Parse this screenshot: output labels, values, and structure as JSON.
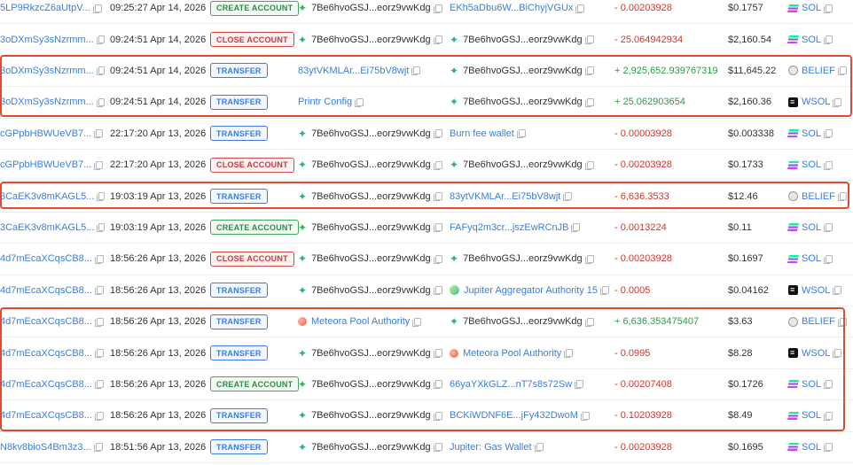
{
  "rows": [
    {
      "sig": "5LP9RkzcZ6aUtpV...",
      "time": "09:25:27 Apr 14, 2026",
      "type": "CREATE ACCOUNT",
      "from": "7Be6hvoGSJ...eorz9vwKdg",
      "from_icon": "spark",
      "to": "EKh5aDbu6W...BiChyjVGUx",
      "to_icon": "none",
      "to_style": "link",
      "from_style": "text",
      "amount": "- 0.00203928",
      "value": "$0.1757",
      "token": "SOL",
      "token_icon": "sol"
    },
    {
      "sig": "3oDXmSy3sNzrmm...",
      "time": "09:24:51 Apr 14, 2026",
      "type": "CLOSE ACCOUNT",
      "from": "7Be6hvoGSJ...eorz9vwKdg",
      "from_icon": "spark",
      "to": "7Be6hvoGSJ...eorz9vwKdg",
      "to_icon": "spark",
      "to_style": "text",
      "from_style": "text",
      "amount": "- 25.064942934",
      "value": "$2,160.54",
      "token": "SOL",
      "token_icon": "sol"
    },
    {
      "sig": "3oDXmSy3sNzrmm...",
      "time": "09:24:51 Apr 14, 2026",
      "type": "TRANSFER",
      "from": "83ytVKMLAr...Ei75bV8wjt",
      "from_icon": "none",
      "to": "7Be6hvoGSJ...eorz9vwKdg",
      "to_icon": "spark",
      "to_style": "text",
      "from_style": "link",
      "amount": "+ 2,925,652.939767319",
      "value": "$11,645.22",
      "token": "BELIEF",
      "token_icon": "belief"
    },
    {
      "sig": "3oDXmSy3sNzrmm...",
      "time": "09:24:51 Apr 14, 2026",
      "type": "TRANSFER",
      "from": "Printr Config",
      "from_icon": "none",
      "to": "7Be6hvoGSJ...eorz9vwKdg",
      "to_icon": "spark",
      "to_style": "text",
      "from_style": "link",
      "amount": "+ 25.062903654",
      "value": "$2,160.36",
      "token": "WSOL",
      "token_icon": "wsol"
    },
    {
      "sig": "cGPpbHBWUeVB7...",
      "time": "22:17:20 Apr 13, 2026",
      "type": "TRANSFER",
      "from": "7Be6hvoGSJ...eorz9vwKdg",
      "from_icon": "spark",
      "to": "Burn fee wallet",
      "to_icon": "none",
      "to_style": "link",
      "from_style": "text",
      "amount": "- 0.00003928",
      "value": "$0.003338",
      "token": "SOL",
      "token_icon": "sol"
    },
    {
      "sig": "cGPpbHBWUeVB7...",
      "time": "22:17:20 Apr 13, 2026",
      "type": "CLOSE ACCOUNT",
      "from": "7Be6hvoGSJ...eorz9vwKdg",
      "from_icon": "spark",
      "to": "7Be6hvoGSJ...eorz9vwKdg",
      "to_icon": "spark",
      "to_style": "text",
      "from_style": "text",
      "amount": "- 0.00203928",
      "value": "$0.1733",
      "token": "SOL",
      "token_icon": "sol"
    },
    {
      "sig": "3CaEK3v8mKAGL5...",
      "time": "19:03:19 Apr 13, 2026",
      "type": "TRANSFER",
      "from": "7Be6hvoGSJ...eorz9vwKdg",
      "from_icon": "spark",
      "to": "83ytVKMLAr...Ei75bV8wjt",
      "to_icon": "none",
      "to_style": "link",
      "from_style": "text",
      "amount": "- 6,636.3533",
      "value": "$12.46",
      "token": "BELIEF",
      "token_icon": "belief"
    },
    {
      "sig": "3CaEK3v8mKAGL5...",
      "time": "19:03:19 Apr 13, 2026",
      "type": "CREATE ACCOUNT",
      "from": "7Be6hvoGSJ...eorz9vwKdg",
      "from_icon": "spark",
      "to": "FAFyq2m3cr...jszEwRCnJB",
      "to_icon": "none",
      "to_style": "link",
      "from_style": "text",
      "amount": "- 0.0013224",
      "value": "$0.11",
      "token": "SOL",
      "token_icon": "sol"
    },
    {
      "sig": "4d7mEcaXCqsCB8...",
      "time": "18:56:26 Apr 13, 2026",
      "type": "CLOSE ACCOUNT",
      "from": "7Be6hvoGSJ...eorz9vwKdg",
      "from_icon": "spark",
      "to": "7Be6hvoGSJ...eorz9vwKdg",
      "to_icon": "spark",
      "to_style": "text",
      "from_style": "text",
      "amount": "- 0.00203928",
      "value": "$0.1697",
      "token": "SOL",
      "token_icon": "sol"
    },
    {
      "sig": "4d7mEcaXCqsCB8...",
      "time": "18:56:26 Apr 13, 2026",
      "type": "TRANSFER",
      "from": "7Be6hvoGSJ...eorz9vwKdg",
      "from_icon": "spark",
      "to": "Jupiter Aggregator Authority 15",
      "to_icon": "jup",
      "to_style": "link",
      "from_style": "text",
      "amount": "- 0.0005",
      "value": "$0.04162",
      "token": "WSOL",
      "token_icon": "wsol"
    },
    {
      "sig": "4d7mEcaXCqsCB8...",
      "time": "18:56:26 Apr 13, 2026",
      "type": "TRANSFER",
      "from": "Meteora Pool Authority",
      "from_icon": "meteora",
      "to": "7Be6hvoGSJ...eorz9vwKdg",
      "to_icon": "spark",
      "to_style": "text",
      "from_style": "link",
      "amount": "+ 6,636.353475407",
      "value": "$3.63",
      "token": "BELIEF",
      "token_icon": "belief"
    },
    {
      "sig": "4d7mEcaXCqsCB8...",
      "time": "18:56:26 Apr 13, 2026",
      "type": "TRANSFER",
      "from": "7Be6hvoGSJ...eorz9vwKdg",
      "from_icon": "spark",
      "to": "Meteora Pool Authority",
      "to_icon": "meteora",
      "to_style": "link",
      "from_style": "text",
      "amount": "- 0.0995",
      "value": "$8.28",
      "token": "WSOL",
      "token_icon": "wsol"
    },
    {
      "sig": "4d7mEcaXCqsCB8...",
      "time": "18:56:26 Apr 13, 2026",
      "type": "CREATE ACCOUNT",
      "from": "7Be6hvoGSJ...eorz9vwKdg",
      "from_icon": "spark",
      "to": "66yaYXkGLZ...nT7s8s72Sw",
      "to_icon": "none",
      "to_style": "link",
      "from_style": "text",
      "amount": "- 0.00207408",
      "value": "$0.1726",
      "token": "SOL",
      "token_icon": "sol"
    },
    {
      "sig": "4d7mEcaXCqsCB8...",
      "time": "18:56:26 Apr 13, 2026",
      "type": "TRANSFER",
      "from": "7Be6hvoGSJ...eorz9vwKdg",
      "from_icon": "spark",
      "to": "BCKiWDNF6E...jFy432DwoM",
      "to_icon": "none",
      "to_style": "link",
      "from_style": "text",
      "amount": "- 0.10203928",
      "value": "$8.49",
      "token": "SOL",
      "token_icon": "sol"
    },
    {
      "sig": "N8kv8bioS4Bm3z3...",
      "time": "18:51:56 Apr 13, 2026",
      "type": "TRANSFER",
      "from": "7Be6hvoGSJ...eorz9vwKdg",
      "from_icon": "spark",
      "to": "Jupiter: Gas Wallet",
      "to_icon": "none",
      "to_style": "link",
      "from_style": "text",
      "amount": "- 0.00203928",
      "value": "$0.1695",
      "token": "SOL",
      "token_icon": "sol"
    }
  ],
  "colors": {
    "link": "#3b7ddd",
    "negative": "#d0362e",
    "positive": "#2a9d48",
    "highlight": "#e04a2f"
  }
}
